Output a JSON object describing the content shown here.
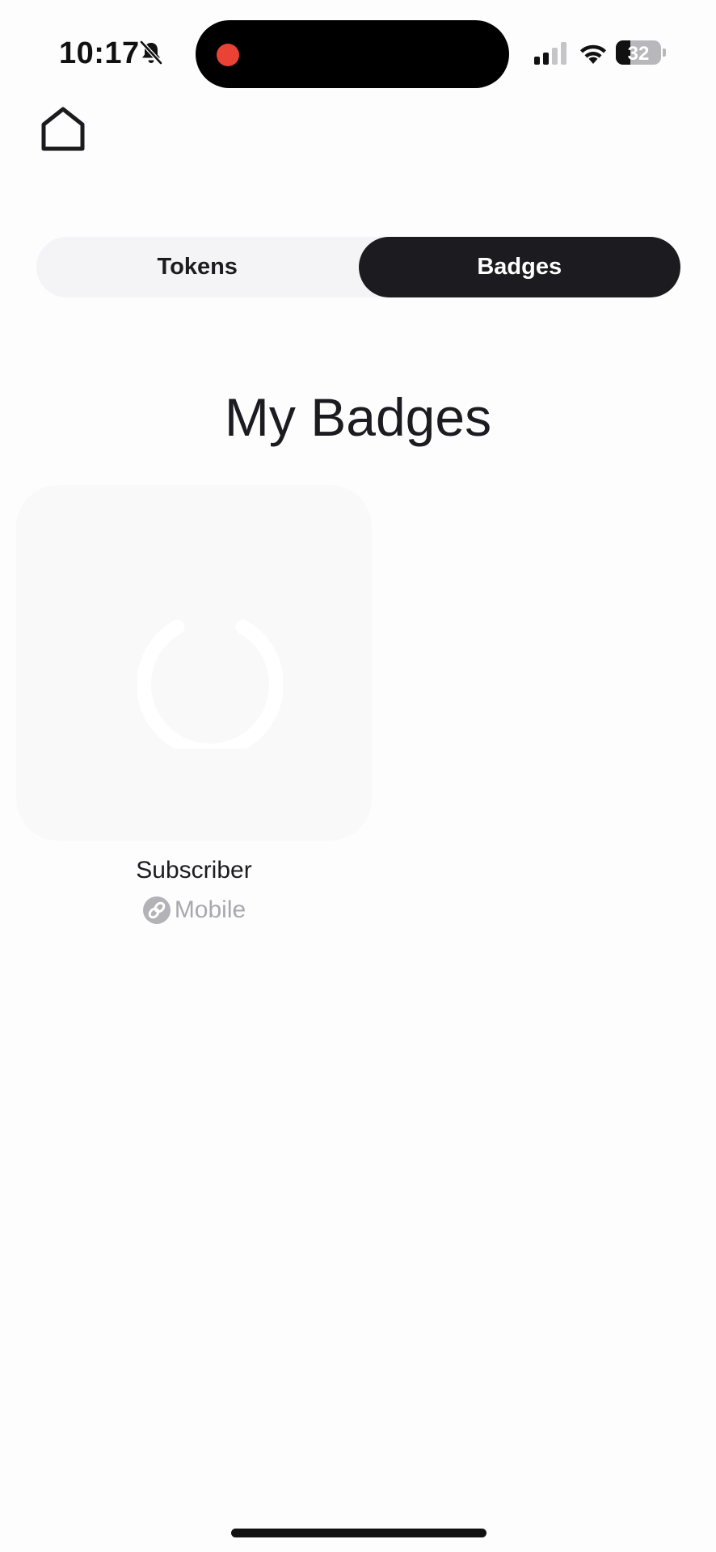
{
  "status_bar": {
    "time": "10:17",
    "battery_level": "32",
    "battery_fraction": 0.32,
    "icons": [
      "bell-slash-icon",
      "signal-icon",
      "wifi-icon",
      "battery-icon"
    ],
    "recording_color": "#ea4335"
  },
  "nav": {
    "home_icon": "home-icon"
  },
  "tabs": {
    "items": [
      {
        "label": "Tokens",
        "selected": false
      },
      {
        "label": "Badges",
        "selected": true
      }
    ],
    "active_bg": "#1c1b20",
    "inactive_bg": "#f4f4f6"
  },
  "main": {
    "title": "My Badges",
    "badges": [
      {
        "name": "Subscriber",
        "source": "Mobile",
        "image_state": "loading-spinner-icon"
      }
    ]
  }
}
